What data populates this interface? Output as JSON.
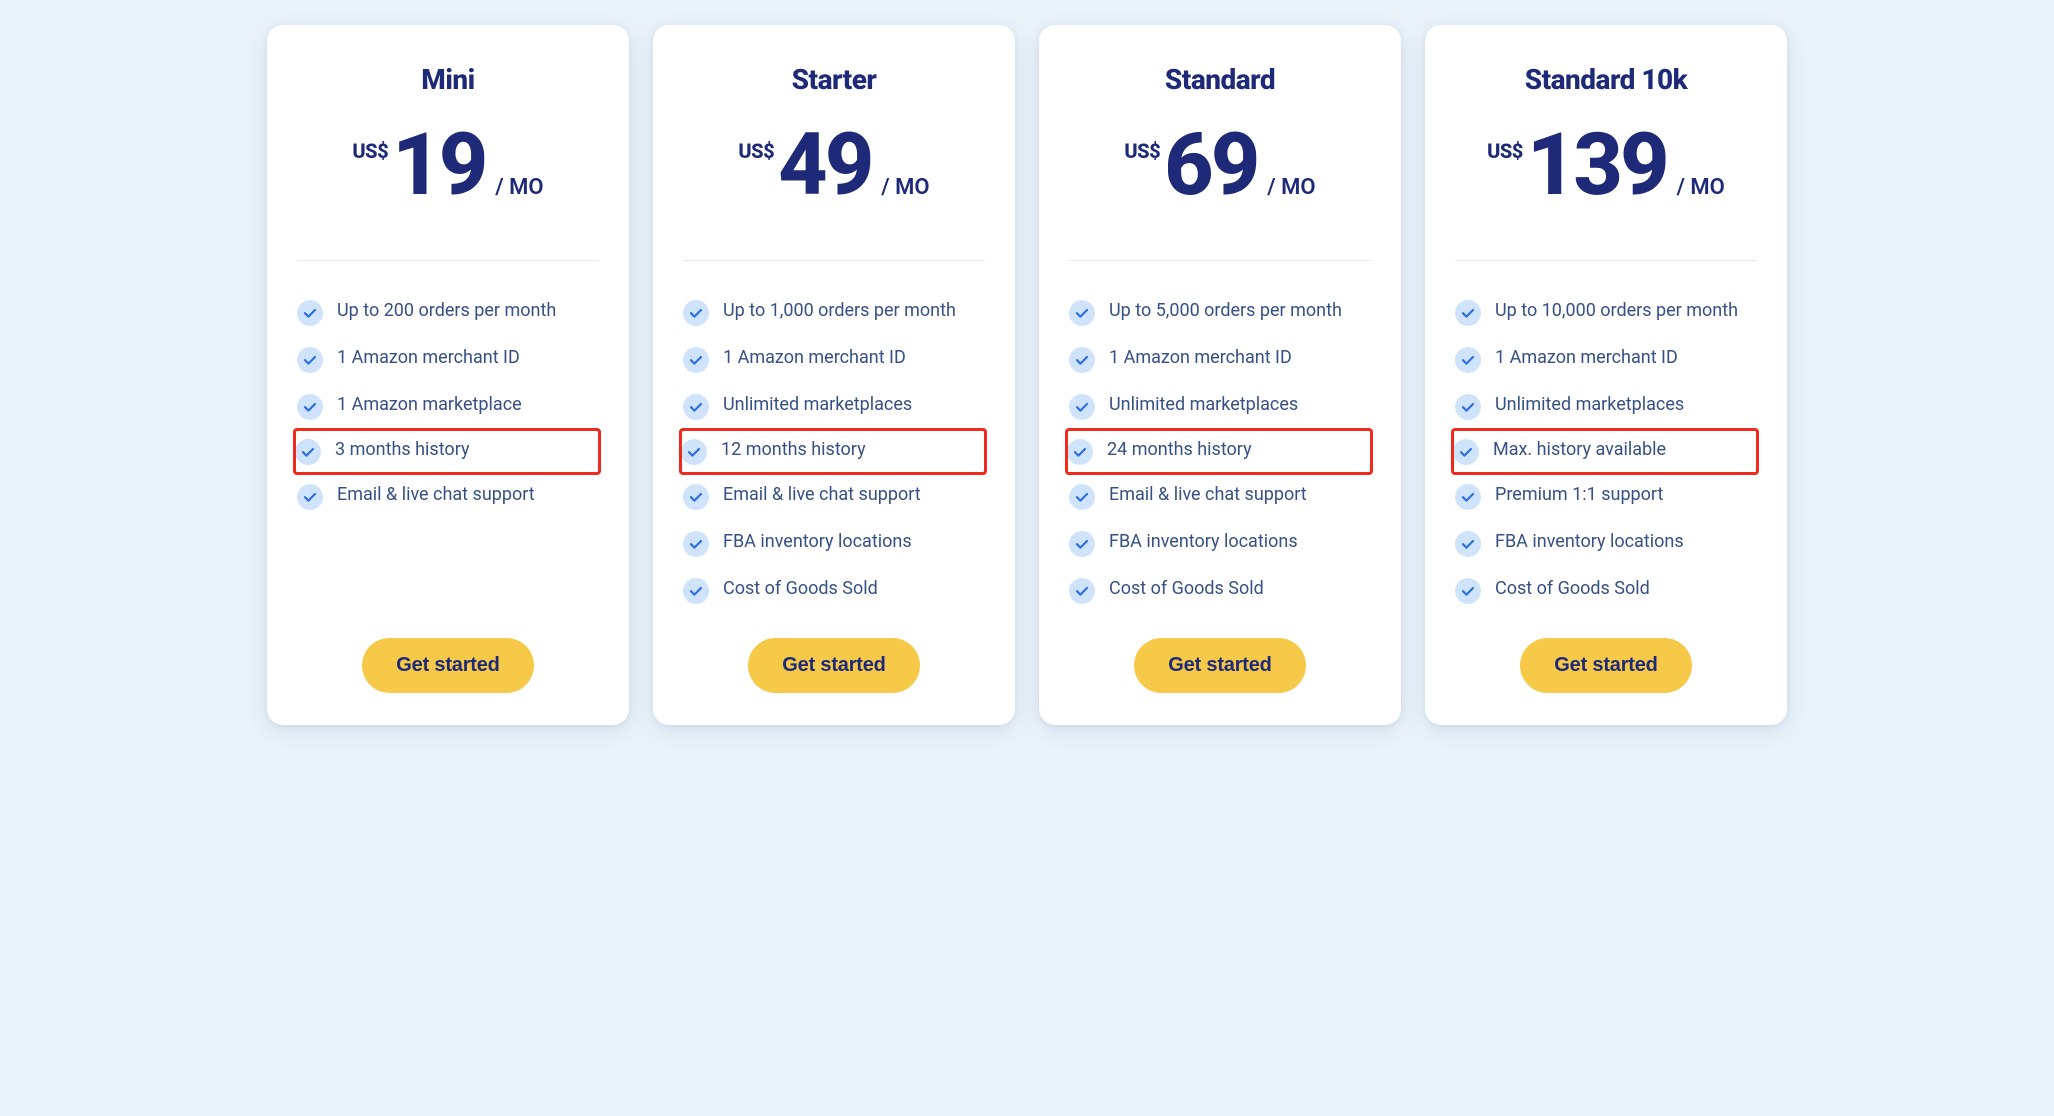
{
  "colors": {
    "brand_text": "#1e2a78",
    "feature_text": "#365085",
    "accent_blue": "#2f6fe4",
    "check_bg": "#cfe3fa",
    "cta_bg": "#f6c948",
    "highlight_border": "#ef2b1e"
  },
  "cta_label": "Get started",
  "plans": [
    {
      "name": "Mini",
      "currency": "US$",
      "amount": "19",
      "period": "/ MO",
      "features": [
        {
          "text": "Up to 200 orders per month",
          "highlight": false
        },
        {
          "text": "1 Amazon merchant ID",
          "highlight": false
        },
        {
          "text": "1 Amazon marketplace",
          "highlight": false
        },
        {
          "text": "3 months history",
          "highlight": true
        },
        {
          "text": "Email & live chat support",
          "highlight": false
        }
      ]
    },
    {
      "name": "Starter",
      "currency": "US$",
      "amount": "49",
      "period": "/ MO",
      "features": [
        {
          "text": "Up to 1,000 orders per month",
          "highlight": false
        },
        {
          "text": "1 Amazon merchant ID",
          "highlight": false
        },
        {
          "text": "Unlimited marketplaces",
          "highlight": false
        },
        {
          "text": "12 months history",
          "highlight": true
        },
        {
          "text": "Email & live chat support",
          "highlight": false
        },
        {
          "text": "FBA inventory locations",
          "highlight": false
        },
        {
          "text": "Cost of Goods Sold",
          "highlight": false
        }
      ]
    },
    {
      "name": "Standard",
      "currency": "US$",
      "amount": "69",
      "period": "/ MO",
      "features": [
        {
          "text": "Up to 5,000 orders per month",
          "highlight": false
        },
        {
          "text": "1 Amazon merchant ID",
          "highlight": false
        },
        {
          "text": "Unlimited marketplaces",
          "highlight": false
        },
        {
          "text": "24 months history",
          "highlight": true
        },
        {
          "text": "Email & live chat support",
          "highlight": false
        },
        {
          "text": "FBA inventory locations",
          "highlight": false
        },
        {
          "text": "Cost of Goods Sold",
          "highlight": false
        }
      ]
    },
    {
      "name": "Standard 10k",
      "currency": "US$",
      "amount": "139",
      "period": "/ MO",
      "features": [
        {
          "text": "Up to 10,000 orders per month",
          "highlight": false
        },
        {
          "text": "1 Amazon merchant ID",
          "highlight": false
        },
        {
          "text": "Unlimited marketplaces",
          "highlight": false
        },
        {
          "text": "Max. history available",
          "highlight": true
        },
        {
          "text": "Premium 1:1 support",
          "highlight": false
        },
        {
          "text": "FBA inventory locations",
          "highlight": false
        },
        {
          "text": "Cost of Goods Sold",
          "highlight": false
        }
      ]
    }
  ]
}
